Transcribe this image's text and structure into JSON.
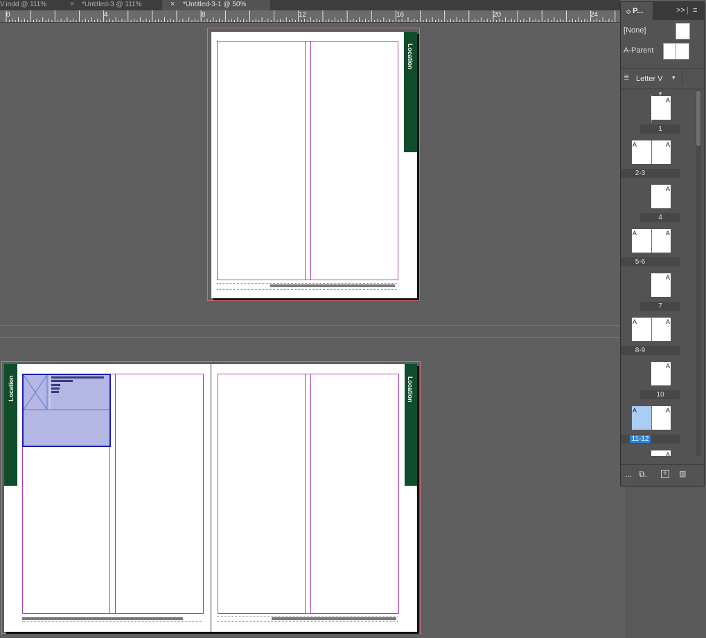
{
  "tabs": [
    {
      "title": "V.indd @ 111%",
      "active": false
    },
    {
      "close": "×",
      "title": "*Untitled-3 @ 111%",
      "active": false
    },
    {
      "close": "×",
      "title": "*Untitled-3-1 @ 50%",
      "active": true
    }
  ],
  "ruler": {
    "labels": [
      "0",
      "4",
      "8",
      "12",
      "16",
      "20",
      "24"
    ]
  },
  "spreads": {
    "tab_label": "Location"
  },
  "panel": {
    "tab_label": "P...",
    "expand_icon": ">>",
    "menu_icon": "≡",
    "parents": [
      {
        "name": "[None]"
      },
      {
        "name": "A-Parent"
      }
    ],
    "page_size": "Letter V",
    "pages": [
      {
        "label": "1",
        "selected": false
      },
      {
        "label": "2-3",
        "selected": false
      },
      {
        "label": "4",
        "selected": false
      },
      {
        "label": "5-6",
        "selected": false
      },
      {
        "label": "7",
        "selected": false
      },
      {
        "label": "8-9",
        "selected": false
      },
      {
        "label": "10",
        "selected": false
      },
      {
        "label": "11-12",
        "selected": true
      }
    ],
    "parent_letter": "A",
    "footer": {
      "more": "...",
      "edit_size": "⧉.",
      "new_page": "+",
      "delete": "🗑"
    }
  }
}
